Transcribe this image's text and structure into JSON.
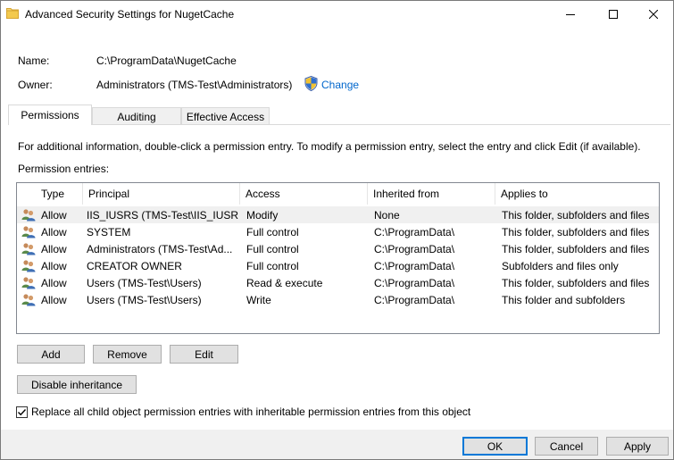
{
  "window": {
    "title": "Advanced Security Settings for NugetCache",
    "folder_color": "#e8b94a"
  },
  "info": {
    "name_label": "Name:",
    "name_value": "C:\\ProgramData\\NugetCache",
    "owner_label": "Owner:",
    "owner_value": "Administrators (TMS-Test\\Administrators)",
    "change_link": "Change"
  },
  "tabs": [
    {
      "label": "Permissions",
      "active": true
    },
    {
      "label": "Auditing",
      "active": false
    },
    {
      "label": "Effective Access",
      "active": false
    }
  ],
  "description": "For additional information, double-click a permission entry. To modify a permission entry, select the entry and click Edit (if available).",
  "permission_entries_label": "Permission entries:",
  "table": {
    "columns": [
      "Type",
      "Principal",
      "Access",
      "Inherited from",
      "Applies to"
    ],
    "rows": [
      {
        "type": "Allow",
        "principal": "IIS_IUSRS (TMS-Test\\IIS_IUSRS)",
        "access": "Modify",
        "inherited": "None",
        "applies": "This folder, subfolders and files",
        "selected": true
      },
      {
        "type": "Allow",
        "principal": "SYSTEM",
        "access": "Full control",
        "inherited": "C:\\ProgramData\\",
        "applies": "This folder, subfolders and files"
      },
      {
        "type": "Allow",
        "principal": "Administrators (TMS-Test\\Ad...",
        "access": "Full control",
        "inherited": "C:\\ProgramData\\",
        "applies": "This folder, subfolders and files"
      },
      {
        "type": "Allow",
        "principal": "CREATOR OWNER",
        "access": "Full control",
        "inherited": "C:\\ProgramData\\",
        "applies": "Subfolders and files only"
      },
      {
        "type": "Allow",
        "principal": "Users (TMS-Test\\Users)",
        "access": "Read & execute",
        "inherited": "C:\\ProgramData\\",
        "applies": "This folder, subfolders and files"
      },
      {
        "type": "Allow",
        "principal": "Users (TMS-Test\\Users)",
        "access": "Write",
        "inherited": "C:\\ProgramData\\",
        "applies": "This folder and subfolders"
      }
    ]
  },
  "buttons": {
    "add": "Add",
    "remove": "Remove",
    "edit": "Edit",
    "disable_inheritance": "Disable inheritance",
    "ok": "OK",
    "cancel": "Cancel",
    "apply": "Apply"
  },
  "replace_checkbox": {
    "label": "Replace all child object permission entries with inheritable permission entries from this object",
    "checked": true
  },
  "colors": {
    "link": "#0066cc",
    "default_button_border": "#0078d7"
  }
}
